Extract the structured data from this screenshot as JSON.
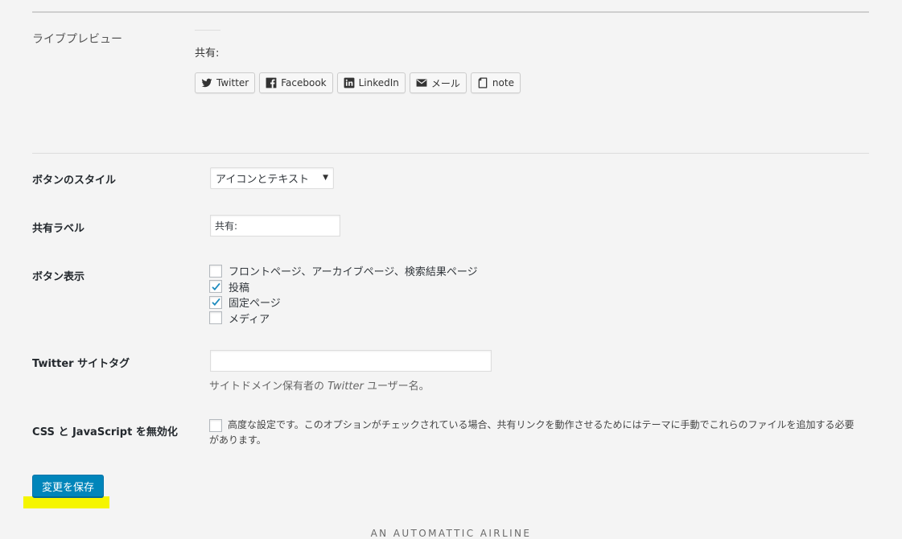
{
  "preview": {
    "label": "ライブプレビュー",
    "share_label": "共有:",
    "buttons": [
      {
        "label": "Twitter",
        "icon": "twitter-icon"
      },
      {
        "label": "Facebook",
        "icon": "facebook-icon"
      },
      {
        "label": "LinkedIn",
        "icon": "linkedin-icon"
      },
      {
        "label": "メール",
        "icon": "mail-icon"
      },
      {
        "label": "note",
        "icon": "note-icon"
      }
    ]
  },
  "button_style": {
    "label": "ボタンのスタイル",
    "selected": "アイコンとテキスト"
  },
  "share_label_setting": {
    "label": "共有ラベル",
    "value": "共有:"
  },
  "button_display": {
    "label": "ボタン表示",
    "options": [
      {
        "label": "フロントページ、アーカイブページ、検索結果ページ",
        "checked": false
      },
      {
        "label": "投稿",
        "checked": true
      },
      {
        "label": "固定ページ",
        "checked": true
      },
      {
        "label": "メディア",
        "checked": false
      }
    ]
  },
  "twitter_site_tag": {
    "label": "Twitter サイトタグ",
    "value": "",
    "description_pre": "サイトドメイン保有者の ",
    "description_em": "Twitter",
    "description_post": " ユーザー名。"
  },
  "disable_css_js": {
    "label": "CSS と JavaScript を無効化",
    "checked": false,
    "description": "高度な設定です。このオプションがチェックされている場合、共有リンクを動作させるためにはテーマに手動でこれらのファイルを追加する必要があります。"
  },
  "save_button": "変更を保存",
  "footer_brand": "AN AUTOMATTIC AIRLINE",
  "colors": {
    "primary_button": "#0085ba",
    "highlight": "#f5f500",
    "background": "#f4f4f4"
  }
}
